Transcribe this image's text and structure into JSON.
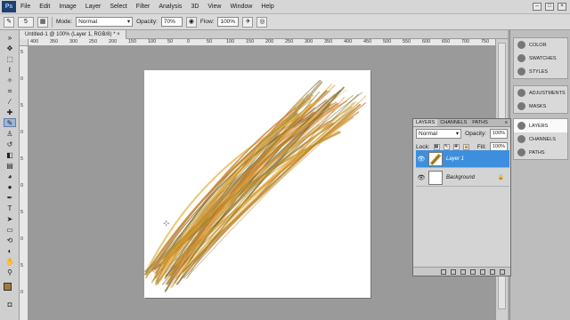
{
  "menu": [
    "File",
    "Edit",
    "Image",
    "Layer",
    "Select",
    "Filter",
    "Analysis",
    "3D",
    "View",
    "Window",
    "Help"
  ],
  "app_logo": "Ps",
  "options": {
    "brush_size": "5",
    "mode_label": "Mode:",
    "mode_value": "Normal",
    "opacity_label": "Opacity:",
    "opacity_value": "70%",
    "flow_label": "Flow:",
    "flow_value": "100%"
  },
  "document": {
    "tab_title": "Untitled-1 @ 100% (Layer 1, RGB/8) *",
    "ruler_top": [
      "400",
      "350",
      "300",
      "250",
      "200",
      "150",
      "100",
      "50",
      "0",
      "50",
      "100",
      "150",
      "200",
      "250",
      "300",
      "350",
      "400",
      "450",
      "500",
      "550",
      "600",
      "650",
      "700",
      "750"
    ],
    "ruler_left": [
      "5",
      "0",
      "5",
      "0",
      "5",
      "0",
      "5",
      "0",
      "5",
      "0"
    ]
  },
  "panels": {
    "group1": [
      {
        "label": "COLOR",
        "icon": "color-icon"
      },
      {
        "label": "SWATCHES",
        "icon": "swatches-icon"
      },
      {
        "label": "STYLES",
        "icon": "styles-icon"
      }
    ],
    "group2": [
      {
        "label": "ADJUSTMENTS",
        "icon": "adjustments-icon"
      },
      {
        "label": "MASKS",
        "icon": "masks-icon"
      }
    ],
    "group3": [
      {
        "label": "LAYERS",
        "icon": "layers-icon"
      },
      {
        "label": "CHANNELS",
        "icon": "channels-icon"
      },
      {
        "label": "PATHS",
        "icon": "paths-icon"
      }
    ]
  },
  "layers_panel": {
    "tabs": [
      "LAYERS",
      "CHANNELS",
      "PATHS"
    ],
    "blend_mode": "Normal",
    "opacity_label": "Opacity:",
    "opacity_value": "100%",
    "lock_label": "Lock:",
    "fill_label": "Fill:",
    "fill_value": "100%",
    "layers": [
      {
        "name": "Layer 1",
        "selected": true
      },
      {
        "name": "Background",
        "selected": false
      }
    ]
  },
  "colors": {
    "accent": "#3d8fde",
    "stroke_dark": "#7a6a2e",
    "stroke_gold": "#d99a2a",
    "stroke_orange": "#e2833a"
  }
}
